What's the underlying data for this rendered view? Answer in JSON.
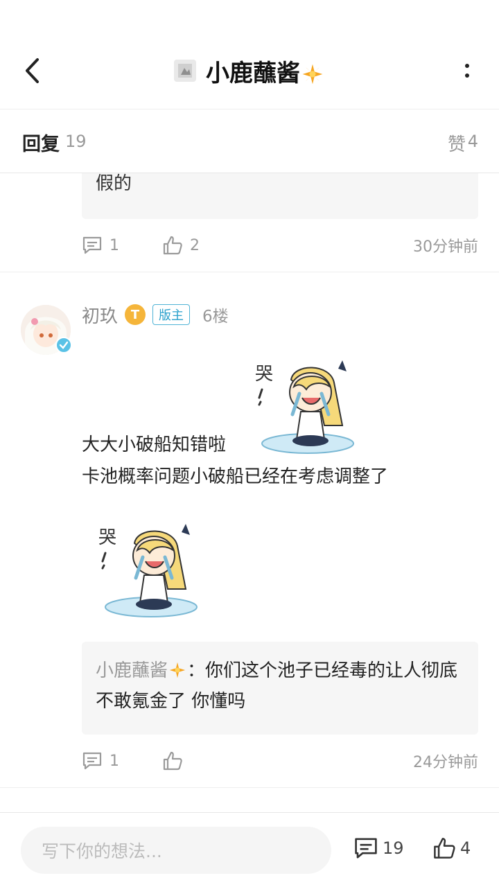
{
  "header": {
    "title": "小鹿蘸酱",
    "back_icon": "chevron-left-icon",
    "more_icon": "more-vertical-icon"
  },
  "subbar": {
    "reply_label": "回复",
    "reply_count": "19",
    "like_label": "赞",
    "like_count": "4"
  },
  "previous": {
    "quote_text": "假的",
    "comment_count": "1",
    "like_count": "2",
    "time": "30分钟前"
  },
  "post": {
    "username": "初玖",
    "level_badge": "T",
    "mod_badge": "版主",
    "floor": "6楼",
    "line1": "大大小破船知错啦",
    "line2": "卡池概率问题小破船已经在考虑调整了",
    "reply_quote": {
      "name": "小鹿蘸酱",
      "text": "你们这个池子已经毒的让人彻底不敢氪金了 你懂吗"
    },
    "comment_count": "1",
    "time": "24分钟前"
  },
  "bottom": {
    "input_placeholder": "写下你的想法...",
    "comment_count": "19",
    "like_count": "4"
  },
  "colors": {
    "accent": "#4fb3d6",
    "badge_gold": "#f5b53a",
    "muted": "#999999"
  }
}
